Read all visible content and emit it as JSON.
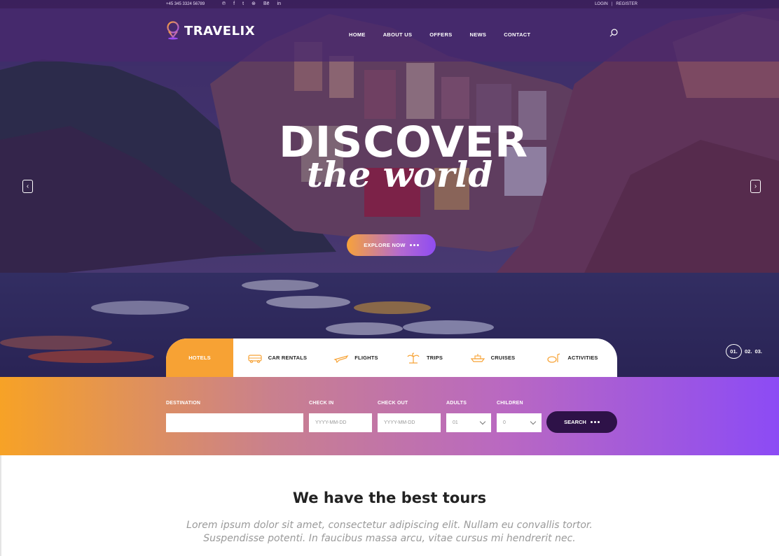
{
  "topbar": {
    "phone": "+45 345 3324 56789",
    "socials": [
      "pinterest-icon",
      "facebook-icon",
      "twitter-icon",
      "dribbble-icon",
      "behance-icon",
      "linkedin-icon"
    ],
    "social_glyphs": [
      "℗",
      "f",
      "t",
      "⊛",
      "Bē",
      "in"
    ],
    "login": "LOGIN",
    "separator": "|",
    "register": "REGISTER"
  },
  "header": {
    "logo": "TRAVELIX",
    "nav": [
      "HOME",
      "ABOUT US",
      "OFFERS",
      "NEWS",
      "CONTACT"
    ]
  },
  "hero": {
    "title": "DISCOVER",
    "script_title": "the world",
    "cta": "EXPLORE NOW",
    "prev": "‹",
    "next": "›",
    "slides": [
      "01.",
      "02.",
      "03."
    ]
  },
  "tabs": [
    {
      "label": "HOTELS",
      "icon": "hotel-icon"
    },
    {
      "label": "CAR RENTALS",
      "icon": "bus-icon"
    },
    {
      "label": "FLIGHTS",
      "icon": "plane-icon"
    },
    {
      "label": "TRIPS",
      "icon": "palm-tree-icon"
    },
    {
      "label": "CRUISES",
      "icon": "ship-icon"
    },
    {
      "label": "ACTIVITIES",
      "icon": "snorkel-icon"
    }
  ],
  "search": {
    "destination_label": "DESTINATION",
    "checkin_label": "CHECK IN",
    "checkin_placeholder": "YYYY-MM-DD",
    "checkout_label": "CHECK OUT",
    "checkout_placeholder": "YYYY-MM-DD",
    "adults_label": "ADULTS",
    "adults_value": "01",
    "children_label": "CHILDREN",
    "children_value": "0",
    "button": "SEARCH"
  },
  "tours": {
    "title": "We have the best tours",
    "line1": "Lorem ipsum dolor sit amet, consectetur adipiscing elit. Nullam eu convallis tortor.",
    "line2": "Suspendisse potenti. In faucibus massa arcu, vitae cursus mi hendrerit nec."
  },
  "colors": {
    "primary_purple": "#8c4bf5",
    "accent_orange": "#f7a234",
    "dark_button": "#2e1248"
  }
}
